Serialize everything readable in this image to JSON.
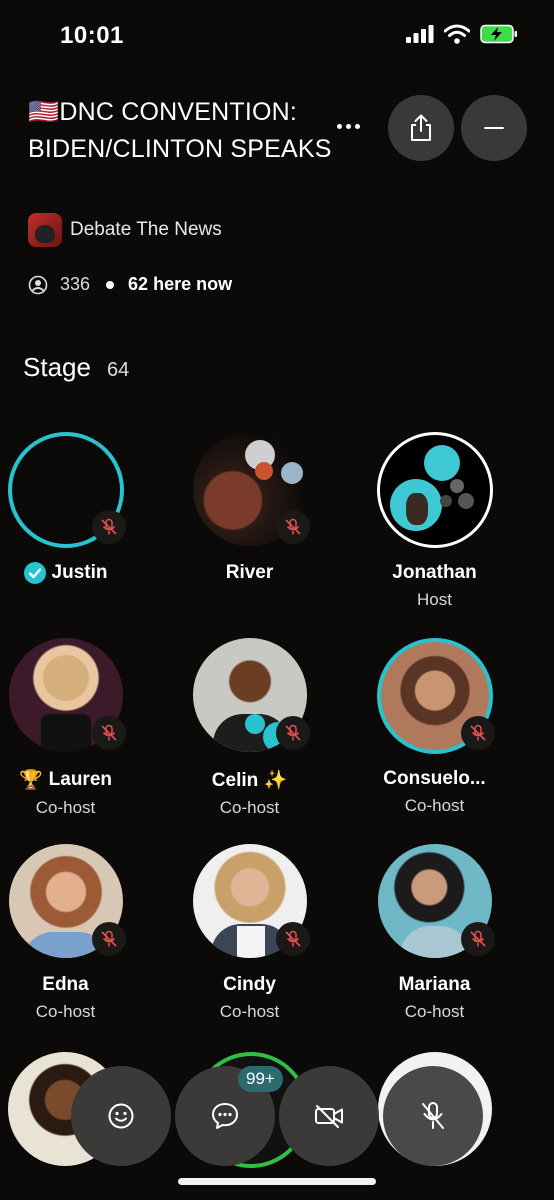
{
  "status_bar": {
    "time": "10:01"
  },
  "room": {
    "title": "🇺🇸DNC CONVENTION: BIDEN/CLINTON SPEAKS",
    "club_name": "Debate The News",
    "listeners": "336",
    "here_now": "62 here now"
  },
  "stage": {
    "label": "Stage",
    "count": "64"
  },
  "users": [
    {
      "name": "Justin",
      "role": ""
    },
    {
      "name": "River",
      "role": ""
    },
    {
      "name": "Jonathan",
      "role": "Host"
    },
    {
      "name": "Lauren",
      "prefix": "🏆",
      "role": "Co-host"
    },
    {
      "name": "Celin ✨",
      "role": "Co-host"
    },
    {
      "name": "Consuelo...",
      "role": "Co-host"
    },
    {
      "name": "Edna",
      "role": "Co-host"
    },
    {
      "name": "Cindy",
      "role": "Co-host"
    },
    {
      "name": "Mariana",
      "role": "Co-host"
    }
  ],
  "chat_badge": "99+",
  "icons": {
    "share": "share-icon",
    "minimize": "minus-icon",
    "more": "more-dots-icon",
    "emoji": "emoji-icon",
    "chat": "chat-icon",
    "video": "video-off-icon",
    "mic": "mic-off-icon"
  },
  "colors": {
    "accent": "#27c3cf",
    "mute_red": "#e2504f",
    "button_gray": "#3a3937"
  }
}
